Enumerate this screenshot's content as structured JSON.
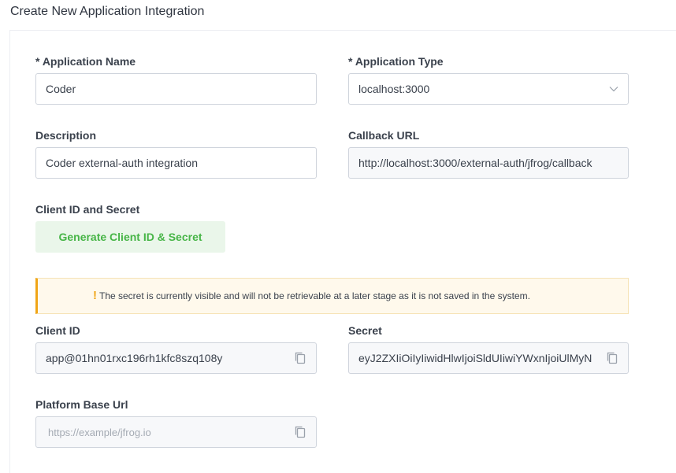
{
  "page": {
    "title": "Create New Application Integration"
  },
  "form": {
    "app_name": {
      "label": "* Application Name",
      "value": "Coder"
    },
    "app_type": {
      "label": "* Application Type",
      "value": "localhost:3000",
      "icon": "chevron-down-icon"
    },
    "description": {
      "label": "Description",
      "value": "Coder external-auth integration"
    },
    "callback_url": {
      "label": "Callback URL",
      "value": "http://localhost:3000/external-auth/jfrog/callback"
    },
    "client_section": {
      "label": "Client ID and Secret",
      "generate_button": "Generate Client ID & Secret"
    },
    "alert": {
      "icon": "warning-icon",
      "text": "The secret is currently visible and will not be retrievable at a later stage as it is not saved in the system."
    },
    "client_id": {
      "label": "Client ID",
      "value": "app@01hn01rxc196rh1kfc8szq108y"
    },
    "secret": {
      "label": "Secret",
      "value": "eyJ2ZXIiOiIyIiwidHlwIjoiSldUIiwiYWxnIjoiUlMyN"
    },
    "platform_url": {
      "label": "Platform Base Url",
      "placeholder": "https://example/jfrog.io"
    }
  },
  "colors": {
    "accent_green": "#47b547",
    "warning_orange": "#f0a516"
  }
}
